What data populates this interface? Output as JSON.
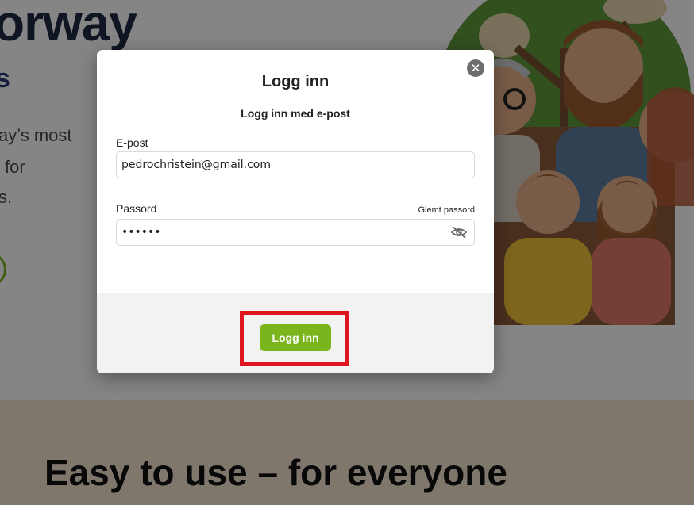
{
  "background": {
    "hero_heading": "orway",
    "hero_subheading": "s",
    "hero_lines": [
      "ay’s most",
      "for",
      "s."
    ],
    "section_heading": "Easy to use – for everyone"
  },
  "modal": {
    "title": "Logg inn",
    "subtitle": "Logg inn med e-post",
    "close_icon": "close-icon",
    "email": {
      "label": "E-post",
      "value": "pedrochristein@gmail.com"
    },
    "password": {
      "label": "Passord",
      "value": "••••••",
      "forgot_label": "Glemt passord",
      "toggle_icon": "eye-slash-icon"
    },
    "submit_label": "Logg inn"
  },
  "colors": {
    "accent": "#7ab51d",
    "highlight": "#e0141e",
    "heading": "#1f2a44"
  }
}
